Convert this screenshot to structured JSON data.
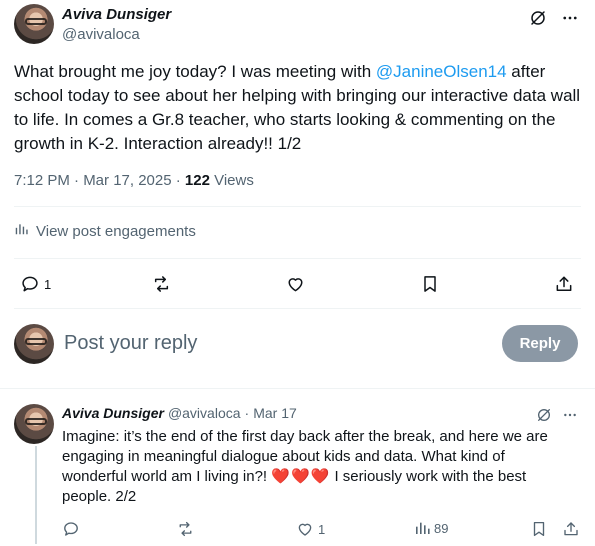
{
  "tweet": {
    "author_name": "Aviva Dunsiger",
    "author_handle": "@avivaloca",
    "text_before": "What brought me joy today? I was meeting with ",
    "mention": "@JanineOlsen14",
    "text_after": " after school today to see about her helping with bringing our interactive data wall to life. In comes a Gr.8 teacher, who starts looking & commenting on the growth in K-2. Interaction already!! 1/2",
    "timestamp": "7:12 PM · Mar 17, 2025 · ",
    "views_count": "122",
    "views_label": " Views",
    "engagements_label": "View post engagements",
    "reply_count": "1"
  },
  "compose": {
    "placeholder": "Post your reply",
    "reply_button": "Reply"
  },
  "reply_tweet": {
    "author_name": "Aviva Dunsiger",
    "author_handle": "@avivaloca",
    "separator": "·",
    "date": "Mar 17",
    "text_before": "Imagine: it’s the end of the first day back after the break, and here we are engaging in meaningful dialogue about kids and data. What kind of wonderful world am I living in?! ",
    "hearts": "❤️❤️❤️",
    "text_after": " I seriously work with the best people. 2/2",
    "like_count": "1",
    "views_count": "89"
  },
  "icons": [
    "grok-icon",
    "more-icon",
    "chart-icon",
    "reply-icon",
    "retweet-icon",
    "like-icon",
    "bookmark-icon",
    "share-icon"
  ],
  "colors": {
    "accent": "#1d9bf0",
    "muted": "#536471",
    "heart": "#e0245e",
    "reply_button_bg": "#8b98a5"
  }
}
